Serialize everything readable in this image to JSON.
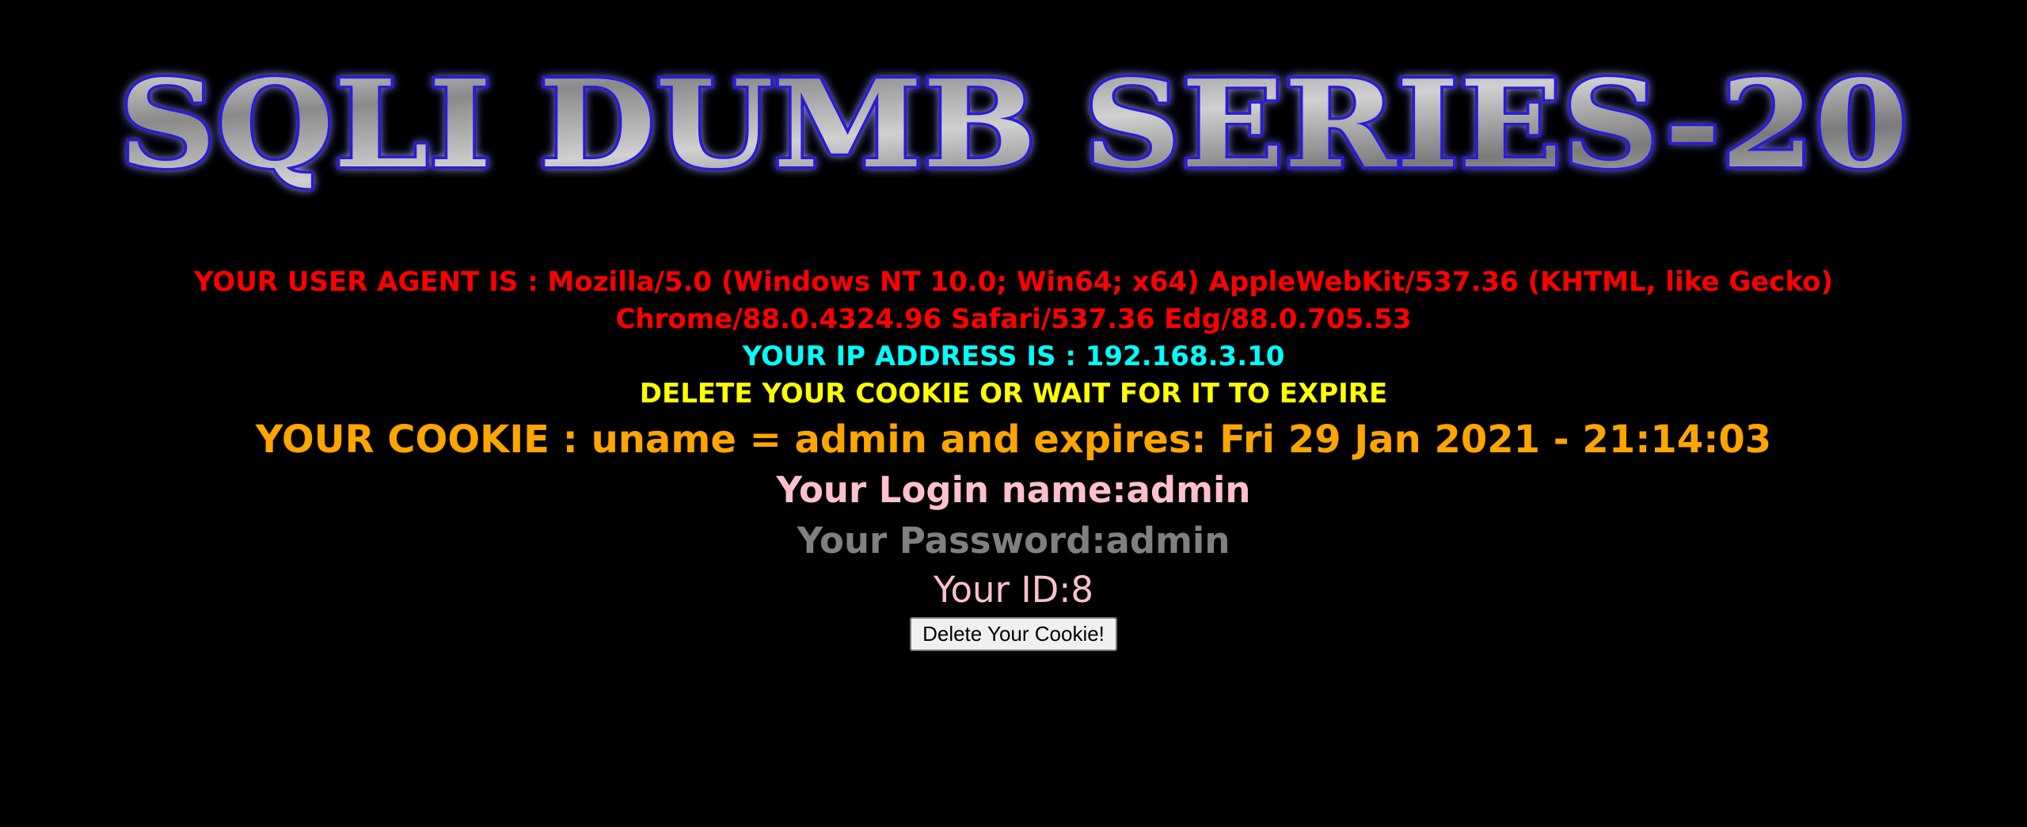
{
  "banner": {
    "title": "SQLI DUMB SERIES-20"
  },
  "info": {
    "user_agent_line": "YOUR USER AGENT IS : Mozilla/5.0 (Windows NT 10.0; Win64; x64) AppleWebKit/537.36 (KHTML, like Gecko) Chrome/88.0.4324.96 Safari/537.36 Edg/88.0.705.53",
    "ip_line": "YOUR IP ADDRESS IS : 192.168.3.10",
    "delete_message": "DELETE YOUR COOKIE OR WAIT FOR IT TO EXPIRE",
    "cookie_line": "YOUR COOKIE : uname = admin and expires: Fri 29 Jan 2021 - 21:14:03",
    "login_line": "Your Login name:admin",
    "password_line": "Your Password:admin",
    "id_line": "Your ID:8"
  },
  "form": {
    "delete_button_label": "Delete Your Cookie!"
  },
  "colors": {
    "background": "#000000",
    "user_agent": "#ff0000",
    "ip": "#00ffff",
    "delete_message": "#ffff00",
    "cookie": "#ffa500",
    "login": "#ffc0cb",
    "password": "#808080",
    "id": "#ffc0cb",
    "banner_glow": "#2a1fd6"
  }
}
